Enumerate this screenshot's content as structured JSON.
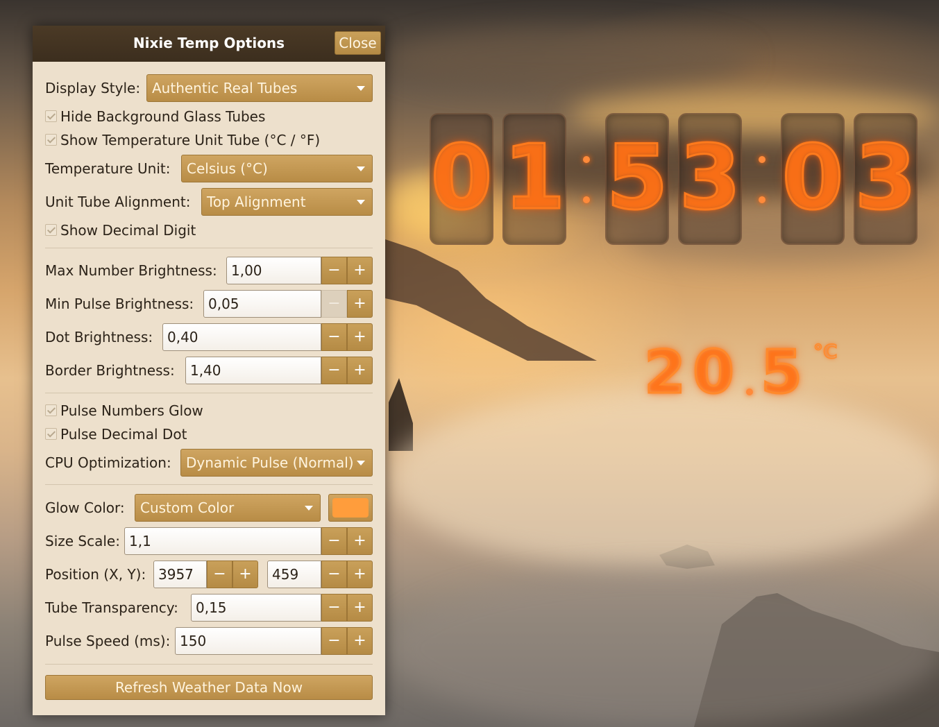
{
  "dialog": {
    "title": "Nixie Temp Options",
    "close_label": "Close",
    "display_style_label": "Display Style:",
    "display_style_value": "Authentic Real Tubes",
    "hide_glass_label": "Hide Background Glass Tubes",
    "show_unit_tube_label": "Show Temperature Unit Tube (°C / °F)",
    "temp_unit_label": "Temperature Unit:",
    "temp_unit_value": "Celsius (°C)",
    "unit_align_label": "Unit Tube Alignment:",
    "unit_align_value": "Top Alignment",
    "show_decimal_label": "Show Decimal Digit",
    "max_brightness_label": "Max Number Brightness:",
    "max_brightness_value": "1,00",
    "min_pulse_label": "Min Pulse Brightness:",
    "min_pulse_value": "0,05",
    "dot_brightness_label": "Dot Brightness:",
    "dot_brightness_value": "0,40",
    "border_brightness_label": "Border Brightness:",
    "border_brightness_value": "1,40",
    "pulse_glow_label": "Pulse Numbers Glow",
    "pulse_dot_label": "Pulse Decimal Dot",
    "cpu_opt_label": "CPU Optimization:",
    "cpu_opt_value": "Dynamic Pulse (Normal)",
    "glow_color_label": "Glow Color:",
    "glow_color_value": "Custom Color",
    "glow_swatch_color": "#ff9d3c",
    "size_scale_label": "Size Scale:",
    "size_scale_value": "1,1",
    "position_label": "Position (X, Y):",
    "position_x": "3957",
    "position_y": "459",
    "transparency_label": "Tube Transparency:",
    "transparency_value": "0,15",
    "pulse_speed_label": "Pulse Speed (ms):",
    "pulse_speed_value": "150",
    "refresh_label": "Refresh Weather Data Now",
    "minus": "−",
    "plus": "+"
  },
  "clock": {
    "d1": "0",
    "d2": "1",
    "d3": "5",
    "d4": "3",
    "d5": "0",
    "d6": "3",
    "glow_color": "#ff7a1c"
  },
  "temperature": {
    "t1": "2",
    "t2": "0",
    "t3": "5",
    "unit": "°C"
  }
}
